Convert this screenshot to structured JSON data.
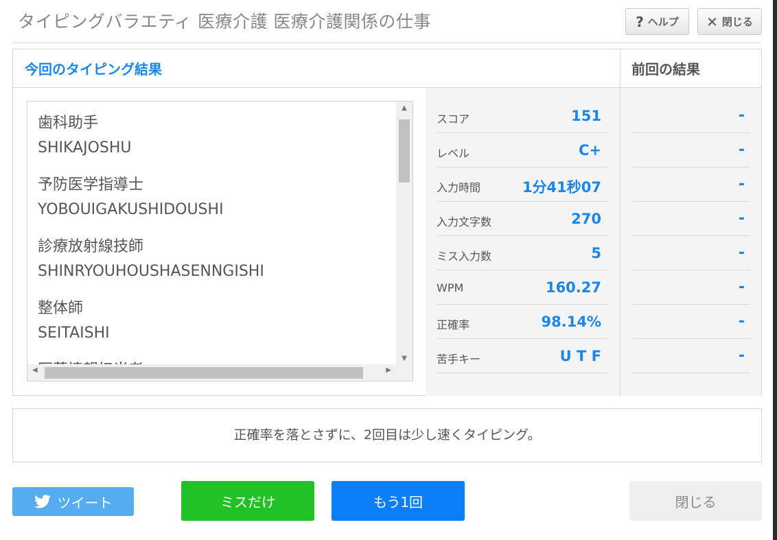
{
  "header": {
    "title": "タイピングバラエティ 医療介護 医療介護関係の仕事",
    "help_label": "ヘルプ",
    "close_label": "閉じる"
  },
  "results": {
    "current_heading": "今回のタイピング結果",
    "previous_heading": "前回の結果",
    "words": [
      {
        "jp": "歯科助手",
        "romaji": "SHIKAJOSHU"
      },
      {
        "jp": "予防医学指導士",
        "romaji": "YOBOUIGAKUSHIDOUSHI"
      },
      {
        "jp": "診療放射線技師",
        "romaji": "SHINRYOUHOUSHASENNGISHI"
      },
      {
        "jp": "整体師",
        "romaji": "SEITAISHI"
      },
      {
        "jp": "医薬情報担当者",
        "romaji": ""
      }
    ],
    "stats": [
      {
        "label": "スコア",
        "value": "151",
        "previous": "-"
      },
      {
        "label": "レベル",
        "value": "C+",
        "previous": "-"
      },
      {
        "label": "入力時間",
        "value": "1分41秒07",
        "previous": "-"
      },
      {
        "label": "入力文字数",
        "value": "270",
        "previous": "-"
      },
      {
        "label": "ミス入力数",
        "value": "5",
        "previous": "-"
      },
      {
        "label": "WPM",
        "value": "160.27",
        "previous": "-"
      },
      {
        "label": "正確率",
        "value": "98.14%",
        "previous": "-"
      },
      {
        "label": "苦手キー",
        "value": "U T F",
        "previous": "-"
      }
    ]
  },
  "advice": "正確率を落とさずに、2回目は少し速くタイピング。",
  "footer": {
    "tweet_label": "ツイート",
    "miss_only_label": "ミスだけ",
    "retry_label": "もう1回",
    "close_label": "閉じる"
  },
  "colors": {
    "accent_blue": "#1a86e8",
    "miss_green": "#22c126",
    "retry_blue": "#0a7ff7",
    "twitter_blue": "#55acee"
  }
}
